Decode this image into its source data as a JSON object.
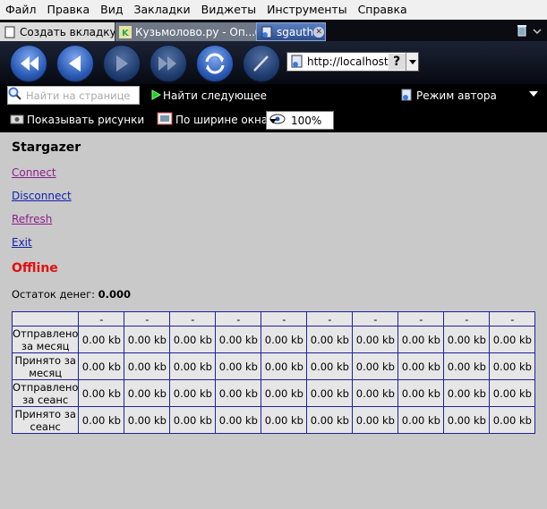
{
  "menu": [
    "Файл",
    "Правка",
    "Вид",
    "Закладки",
    "Виджеты",
    "Инструменты",
    "Справка"
  ],
  "tabs": {
    "new_tab": "Создать вкладку",
    "tab1": "Кузьмолово.ру - Оп...",
    "tab2": "sgauth"
  },
  "address": {
    "url": "http://localhost",
    "help": "?"
  },
  "findbar": {
    "placeholder": "Найти на странице",
    "find_next": "Найти следующее",
    "author_mode": "Режим автора"
  },
  "viewbar": {
    "show_images": "Показывать рисунки",
    "fit_width": "По ширине окна",
    "zoom": "100%"
  },
  "page": {
    "title": "Stargazer",
    "links": {
      "connect": "Connect",
      "disconnect": "Disconnect",
      "refresh": "Refresh",
      "exit": "Exit"
    },
    "status": "Offline",
    "balance_label": "Остаток денег:",
    "balance_value": "0.000"
  },
  "table": {
    "headers": [
      "-",
      "-",
      "-",
      "-",
      "-",
      "-",
      "-",
      "-",
      "-",
      "-"
    ],
    "rows": [
      {
        "label": [
          "Отправлено",
          "за месяц"
        ],
        "values": [
          "0.00 kb",
          "0.00 kb",
          "0.00 kb",
          "0.00 kb",
          "0.00 kb",
          "0.00 kb",
          "0.00 kb",
          "0.00 kb",
          "0.00 kb",
          "0.00 kb"
        ]
      },
      {
        "label": [
          "Принято за",
          "месяц"
        ],
        "values": [
          "0.00 kb",
          "0.00 kb",
          "0.00 kb",
          "0.00 kb",
          "0.00 kb",
          "0.00 kb",
          "0.00 kb",
          "0.00 kb",
          "0.00 kb",
          "0.00 kb"
        ]
      },
      {
        "label": [
          "Отправлено",
          "за сеанс"
        ],
        "values": [
          "0.00 kb",
          "0.00 kb",
          "0.00 kb",
          "0.00 kb",
          "0.00 kb",
          "0.00 kb",
          "0.00 kb",
          "0.00 kb",
          "0.00 kb",
          "0.00 kb"
        ]
      },
      {
        "label": [
          "Принято за",
          "сеанс"
        ],
        "values": [
          "0.00 kb",
          "0.00 kb",
          "0.00 kb",
          "0.00 kb",
          "0.00 kb",
          "0.00 kb",
          "0.00 kb",
          "0.00 kb",
          "0.00 kb",
          "0.00 kb"
        ]
      }
    ]
  }
}
